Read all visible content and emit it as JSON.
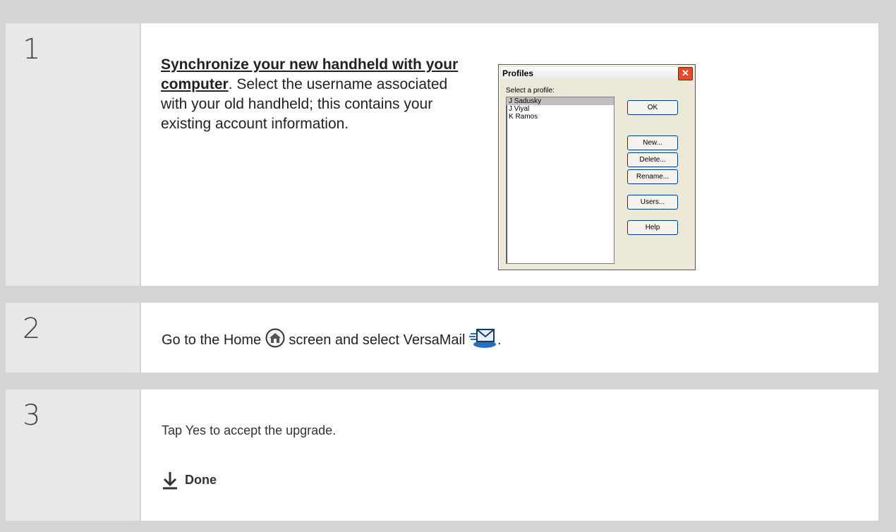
{
  "steps": [
    {
      "number": "1",
      "link_text": "Synchronize your new handheld with your computer",
      "text": ". Select the username associated with your old handheld; this contains your existing account information."
    },
    {
      "number": "2",
      "text_before": "Go to the Home",
      "text_middle": "screen and select VersaMail",
      "text_after": "."
    },
    {
      "number": "3",
      "text": "Tap Yes to accept the upgrade.",
      "done_label": "Done"
    }
  ],
  "dialog": {
    "title": "Profiles",
    "label": "Select a profile:",
    "profiles": [
      "J Sadusky",
      "J Viyal",
      "K Ramos"
    ],
    "selected": "J Sadusky",
    "buttons": {
      "ok": "OK",
      "new": "New...",
      "delete": "Delete...",
      "rename": "Rename...",
      "users": "Users...",
      "help": "Help"
    }
  },
  "icons": {
    "home": "home-icon",
    "versamail": "versamail-icon",
    "done": "arrow-down-icon"
  },
  "colors": {
    "background": "#d4d4d4",
    "number_cell": "#e8e8e8",
    "content_cell": "#ffffff"
  }
}
